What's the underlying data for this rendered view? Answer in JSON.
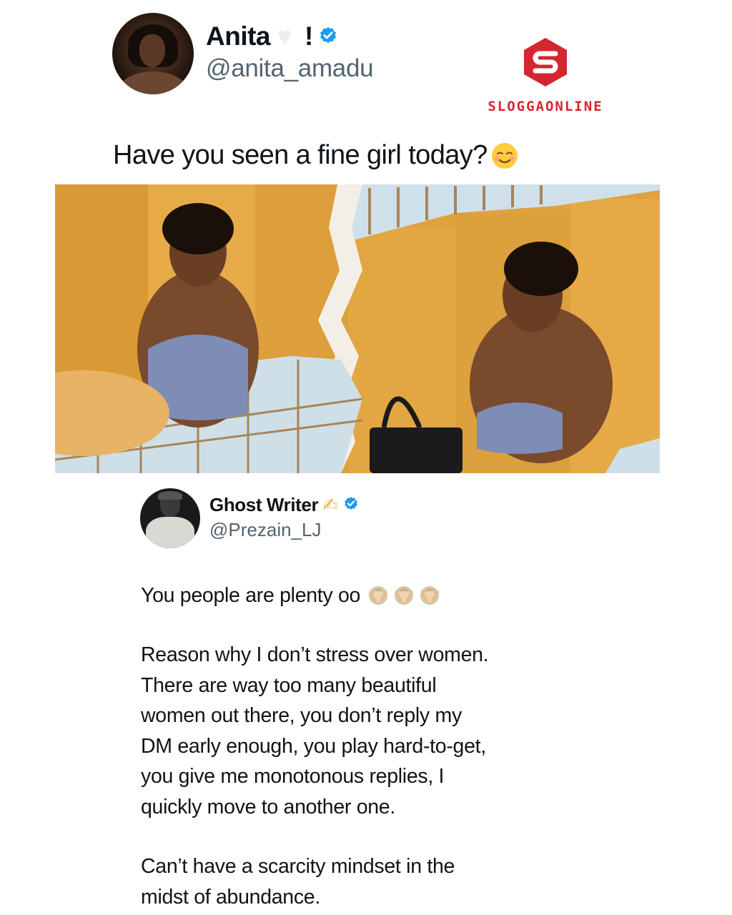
{
  "tweet": {
    "author_name": "Anita",
    "author_name_suffix": "!",
    "author_handle": "@anita_amadu",
    "verified": true,
    "text": "Have you seen a fine girl today?",
    "text_emoji": "smiling-face-icon"
  },
  "watermark": {
    "brand": "SLOGGAONLINE",
    "color": "#d5262f"
  },
  "quoted_tweet": {
    "author_name": "Ghost Writer",
    "author_handle": "@Prezain_LJ",
    "verified": true,
    "paragraph_1": "You people are plenty oo",
    "paragraph_2_lines": [
      "Reason why I don’t stress over women.",
      "There are way too many beautiful",
      "women out there, you don’t reply my",
      "DM early enough, you play hard-to-get,",
      "you give me monotonous replies, I",
      "quickly move to another one."
    ],
    "paragraph_3_lines": [
      "Can’t have a scarcity mindset in the",
      "midst of abundance."
    ]
  },
  "colors": {
    "verified_blue": "#1d9bf0",
    "handle_gray": "#536471",
    "photo_background": "#e3a43f"
  }
}
